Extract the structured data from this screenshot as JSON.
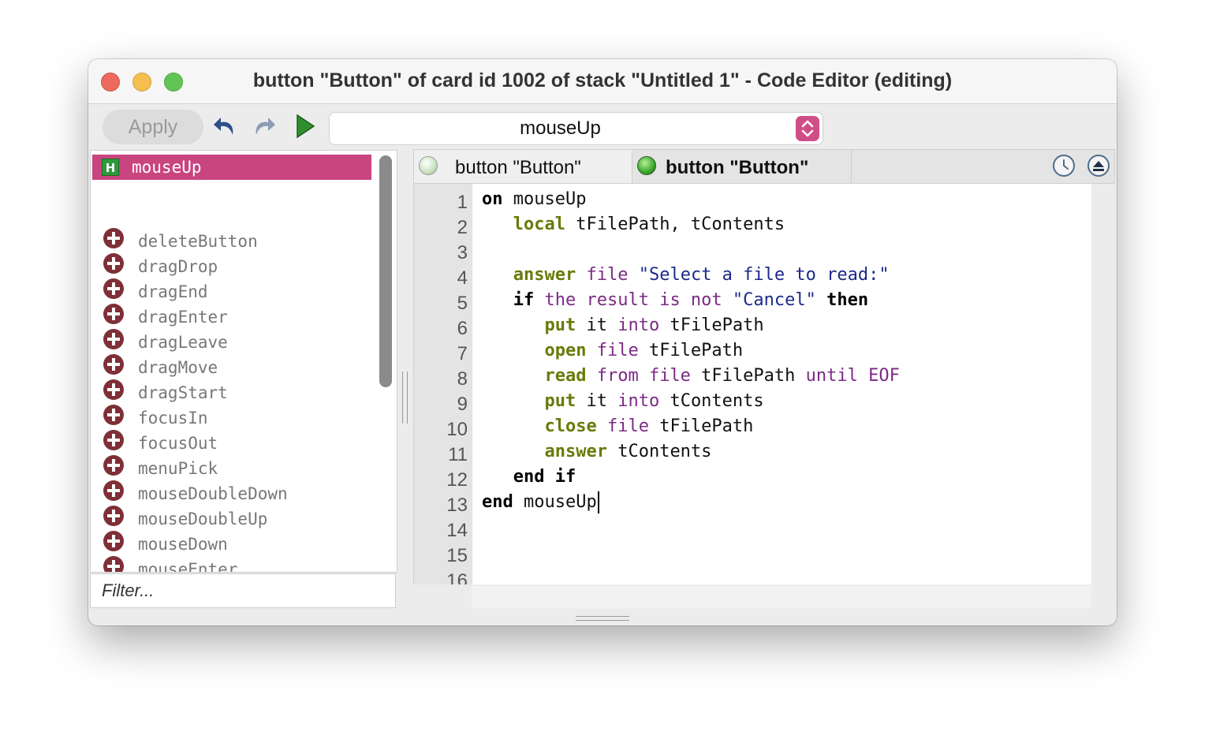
{
  "window": {
    "title": "button \"Button\" of card id 1002 of stack \"Untitled 1\" - Code Editor (editing)"
  },
  "toolbar": {
    "apply_label": "Apply",
    "undo_icon": "undo-arrow-icon",
    "redo_icon": "redo-arrow-icon",
    "run_icon": "play-triangle-icon",
    "handler_select_value": "mouseUp"
  },
  "sidebar": {
    "selected_handler": "mouseUp",
    "handler_icon_letter": "H",
    "messages": [
      "deleteButton",
      "dragDrop",
      "dragEnd",
      "dragEnter",
      "dragLeave",
      "dragMove",
      "dragStart",
      "focusIn",
      "focusOut",
      "menuPick",
      "mouseDoubleDown",
      "mouseDoubleUp",
      "mouseDown",
      "mouseEnter"
    ],
    "filter_placeholder": "Filter..."
  },
  "tabs": [
    {
      "label": "button \"Button\"",
      "active": false
    },
    {
      "label": "button \"Button\"",
      "active": true
    }
  ],
  "editor": {
    "line_numbers": [
      "1",
      "2",
      "3",
      "4",
      "5",
      "6",
      "7",
      "8",
      "9",
      "10",
      "11",
      "12",
      "13",
      "14",
      "15",
      "16"
    ],
    "lines": [
      [
        {
          "t": "on",
          "c": "kw"
        },
        {
          "t": " mouseUp",
          "c": ""
        }
      ],
      [
        {
          "t": "   ",
          "c": ""
        },
        {
          "t": "local",
          "c": "cmd"
        },
        {
          "t": " tFilePath, tContents",
          "c": ""
        }
      ],
      [],
      [
        {
          "t": "   ",
          "c": ""
        },
        {
          "t": "answer",
          "c": "cmd"
        },
        {
          "t": " ",
          "c": ""
        },
        {
          "t": "file",
          "c": "pp"
        },
        {
          "t": " ",
          "c": ""
        },
        {
          "t": "\"Select a file to read:\"",
          "c": "str"
        }
      ],
      [
        {
          "t": "   ",
          "c": ""
        },
        {
          "t": "if",
          "c": "kw"
        },
        {
          "t": " ",
          "c": ""
        },
        {
          "t": "the result is not",
          "c": "pp"
        },
        {
          "t": " ",
          "c": ""
        },
        {
          "t": "\"Cancel\"",
          "c": "str"
        },
        {
          "t": " ",
          "c": ""
        },
        {
          "t": "then",
          "c": "kw"
        }
      ],
      [
        {
          "t": "      ",
          "c": ""
        },
        {
          "t": "put",
          "c": "cmd"
        },
        {
          "t": " it ",
          "c": ""
        },
        {
          "t": "into",
          "c": "pp"
        },
        {
          "t": " tFilePath",
          "c": ""
        }
      ],
      [
        {
          "t": "      ",
          "c": ""
        },
        {
          "t": "open",
          "c": "cmd"
        },
        {
          "t": " ",
          "c": ""
        },
        {
          "t": "file",
          "c": "pp"
        },
        {
          "t": " tFilePath",
          "c": ""
        }
      ],
      [
        {
          "t": "      ",
          "c": ""
        },
        {
          "t": "read",
          "c": "cmd"
        },
        {
          "t": " ",
          "c": ""
        },
        {
          "t": "from file",
          "c": "pp"
        },
        {
          "t": " tFilePath ",
          "c": ""
        },
        {
          "t": "until EOF",
          "c": "pp"
        }
      ],
      [
        {
          "t": "      ",
          "c": ""
        },
        {
          "t": "put",
          "c": "cmd"
        },
        {
          "t": " it ",
          "c": ""
        },
        {
          "t": "into",
          "c": "pp"
        },
        {
          "t": " tContents",
          "c": ""
        }
      ],
      [
        {
          "t": "      ",
          "c": ""
        },
        {
          "t": "close",
          "c": "cmd"
        },
        {
          "t": " ",
          "c": ""
        },
        {
          "t": "file",
          "c": "pp"
        },
        {
          "t": " tFilePath",
          "c": ""
        }
      ],
      [
        {
          "t": "      ",
          "c": ""
        },
        {
          "t": "answer",
          "c": "cmd"
        },
        {
          "t": " tContents",
          "c": ""
        }
      ],
      [
        {
          "t": "   ",
          "c": ""
        },
        {
          "t": "end if",
          "c": "kw"
        }
      ],
      [
        {
          "t": "end",
          "c": "kw"
        },
        {
          "t": " mouseUp",
          "c": ""
        }
      ]
    ]
  },
  "colors": {
    "accent_pink": "#c84580",
    "handler_green": "#2e9a3b",
    "plus_icon": "#7e3036",
    "command_olive": "#6a7a0a",
    "property_purple": "#7d2a86",
    "string_blue": "#1b2a8a"
  }
}
